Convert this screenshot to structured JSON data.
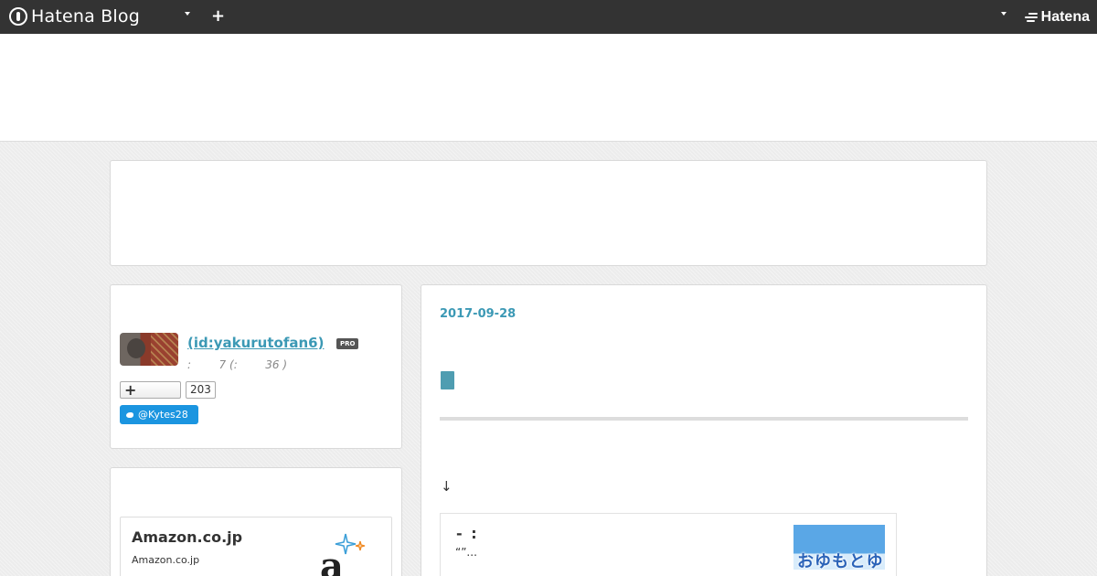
{
  "global_header": {
    "logo_text": "Hatena Blog",
    "add_label": "+",
    "brand_right": "Hatena",
    "icons": {
      "logo": "hatena-blog-logo-icon",
      "dropdown": "chevron-down-icon",
      "add": "plus-icon",
      "brand": "hatena-logo-icon"
    }
  },
  "profile": {
    "name": " (id:yakurutofan6)",
    "badge": "PRO",
    "stats": ":        7 (:        36 )",
    "follow_label": "+",
    "follower_count": "203",
    "twitter_handle": "@Kytes28",
    "colors": {
      "link": "#3c99b5",
      "twitter": "#1b95e0"
    }
  },
  "amazon": {
    "title": "Amazon.co.jp",
    "subtitle": "Amazon.co.jp",
    "logo_letter": "a"
  },
  "article": {
    "date": "2017-09-28",
    "arrow": "↓",
    "embed": {
      "title": "- :",
      "description": "“”...",
      "thumb_text": "おゆもとゆ"
    }
  }
}
